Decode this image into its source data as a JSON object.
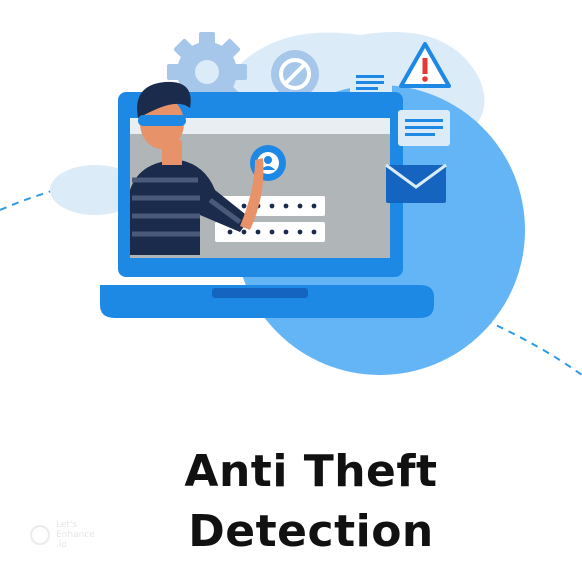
{
  "title": {
    "line1": "Anti Theft",
    "line2": "Detection"
  },
  "watermark": {
    "text": "Let's\nEnhance\n.io"
  },
  "illustration": {
    "icons": [
      "gear-icon",
      "block-icon",
      "warning-icon",
      "document-icon",
      "envelope-icon",
      "user-icon"
    ],
    "colors": {
      "primary_blue": "#1e88e5",
      "light_blue": "#64b5f6",
      "pale_blue": "#dcebf8",
      "screen_gray": "#b0b5b8",
      "dark_navy": "#1a2b4c"
    }
  }
}
